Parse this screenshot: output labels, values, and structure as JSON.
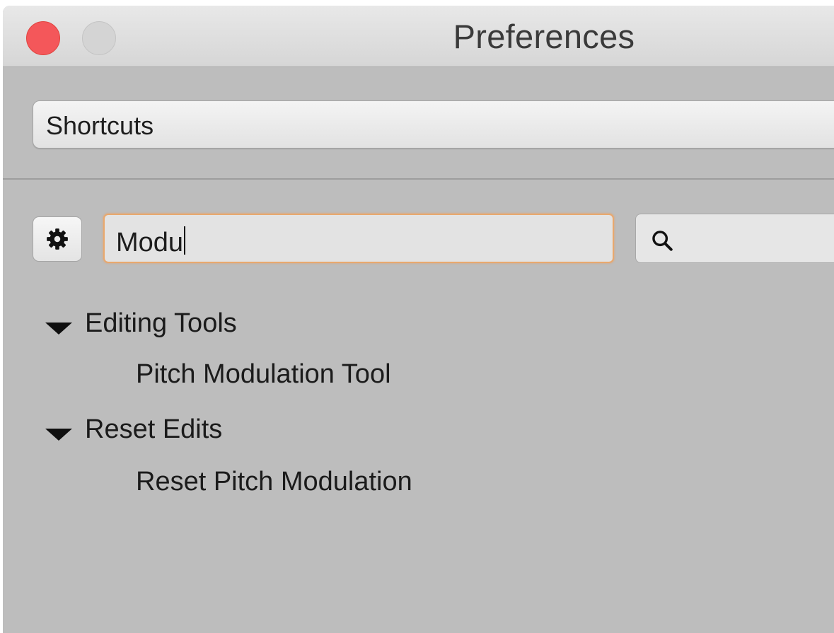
{
  "window": {
    "title": "Preferences",
    "close_button_color": "#f4575a",
    "disabled_button_color": "#d4d4d4"
  },
  "category_select": {
    "selected": "Shortcuts"
  },
  "toolbar": {
    "gear_icon": "gear-icon",
    "filter_value": "Modu",
    "filter_focus_color": "#e8a86e",
    "search_icon": "search-icon",
    "search_value": ""
  },
  "tree": {
    "groups": [
      {
        "label": "Editing Tools",
        "expanded": true,
        "items": [
          "Pitch Modulation Tool"
        ]
      },
      {
        "label": "Reset Edits",
        "expanded": true,
        "items": [
          "Reset Pitch Modulation"
        ]
      }
    ]
  }
}
